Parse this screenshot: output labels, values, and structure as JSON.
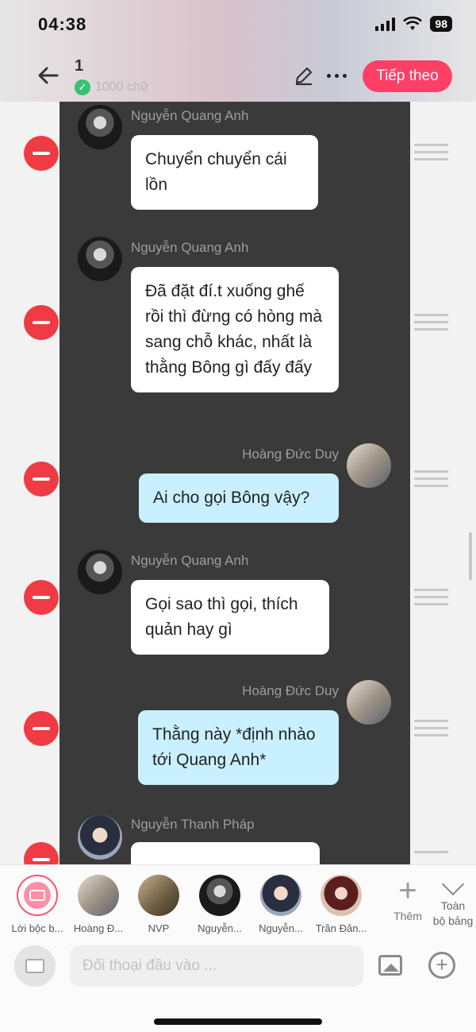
{
  "status": {
    "time": "04:38",
    "battery": "98"
  },
  "header": {
    "title": "1",
    "word_count": "1000 chữ",
    "next_label": "Tiếp theo"
  },
  "messages": [
    {
      "sender": "Nguyễn Quang Anh",
      "text": "Chuyển chuyển cái lồn",
      "side": "left"
    },
    {
      "sender": "Nguyễn Quang Anh",
      "text": "Đã đặt đí.t xuống ghế rồi thì đừng có hòng mà sang chỗ khác, nhất là thằng Bông gì đấy đấy",
      "side": "left"
    },
    {
      "sender": "Hoàng Đức Duy",
      "text": "Ai cho gọi Bông vậy?",
      "side": "right"
    },
    {
      "sender": "Nguyễn Quang Anh",
      "text": "Gọi sao thì gọi, thích quản hay gì",
      "side": "left"
    },
    {
      "sender": "Hoàng Đức Duy",
      "text": "Thằng này *định nhào tới Quang Anh*",
      "side": "right"
    },
    {
      "sender": "Nguyễn Thanh Pháp",
      "text": "",
      "side": "left"
    }
  ],
  "characters": [
    {
      "name": "Lời bộc b..."
    },
    {
      "name": "Hoàng Đ..."
    },
    {
      "name": "NVP"
    },
    {
      "name": "Nguyễn..."
    },
    {
      "name": "Nguyễn..."
    },
    {
      "name": "Trần Đăn..."
    }
  ],
  "add_character": {
    "label": "Thêm"
  },
  "expand": {
    "line1": "Toàn",
    "line2": "bộ bảng"
  },
  "composer": {
    "placeholder": "Đối thoại đầu vào ..."
  }
}
